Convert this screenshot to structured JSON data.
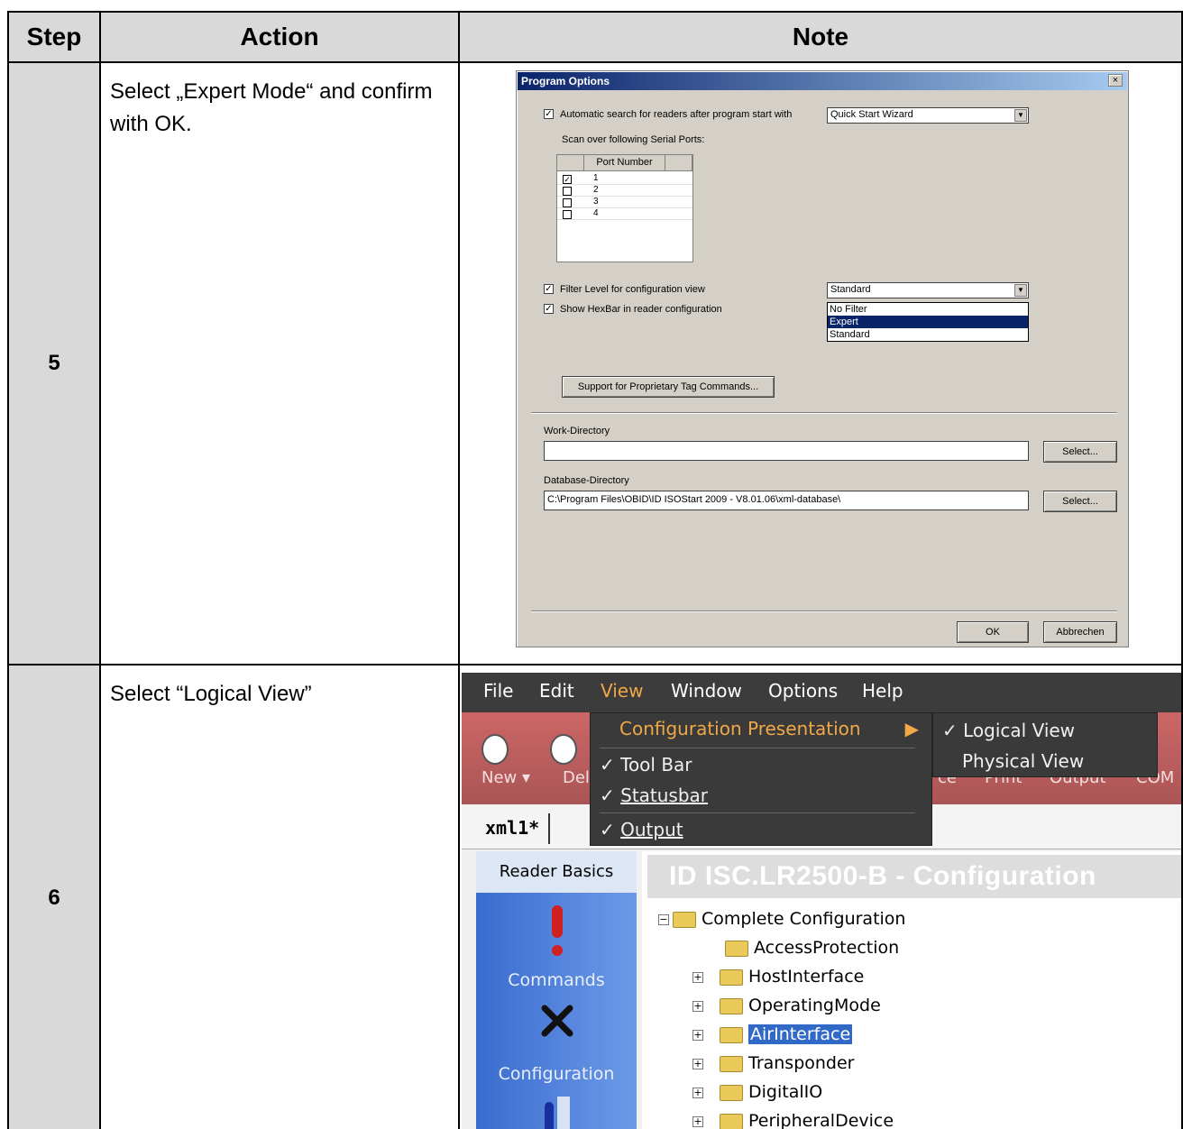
{
  "table": {
    "headers": {
      "step": "Step",
      "action": "Action",
      "note": "Note"
    },
    "rows": [
      {
        "step": "5",
        "action": "Select „Expert Mode“ and confirm with OK."
      },
      {
        "step": "6",
        "action": "Select “Logical View”"
      }
    ]
  },
  "dialog": {
    "title": "Program Options",
    "close": "×",
    "auto_search_label": "Automatic search for readers after program start with",
    "auto_search_value": "Quick Start Wizard",
    "scan_ports_label": "Scan over following Serial Ports:",
    "port_header": "Port Number",
    "ports": [
      {
        "number": "1",
        "checked": "☑"
      },
      {
        "number": "2",
        "checked": ""
      },
      {
        "number": "3",
        "checked": ""
      },
      {
        "number": "4",
        "checked": ""
      }
    ],
    "filter_label": "Filter Level for configuration view",
    "filter_value": "Standard",
    "filter_options": [
      "No Filter",
      "Expert",
      "Standard"
    ],
    "hexbar_label": "Show HexBar in reader configuration",
    "proprietary_button": "Support for Proprietary Tag Commands...",
    "work_dir_label": "Work-Directory",
    "work_dir_value": "",
    "db_dir_label": "Database-Directory",
    "db_dir_value": "C:\\Program Files\\OBID\\ID ISOStart 2009 - V8.01.06\\xml-database\\",
    "select_button": "Select...",
    "ok_button": "OK",
    "cancel_button": "Abbrechen"
  },
  "app": {
    "menu": [
      "File",
      "Edit",
      "View",
      "Window",
      "Options",
      "Help"
    ],
    "toolbar_labels": [
      "New ▾",
      "Del",
      "ce",
      "Print",
      "Output",
      "COM"
    ],
    "tab": "xml1*",
    "view_menu": {
      "config_presentation": "Configuration Presentation",
      "tool_bar": "Tool Bar",
      "statusbar": "Statusbar",
      "output": "Output"
    },
    "submenu": {
      "logical": "Logical View",
      "physical": "Physical View"
    },
    "sidebar": {
      "header": "Reader Basics",
      "commands": "Commands",
      "configuration": "Configuration"
    },
    "main_title": "ID ISC.LR2500-B - Configuration",
    "tree": [
      "Complete Configuration",
      "AccessProtection",
      "HostInterface",
      "OperatingMode",
      "AirInterface",
      "Transponder",
      "DigitalIO",
      "PeripheralDevice"
    ]
  }
}
